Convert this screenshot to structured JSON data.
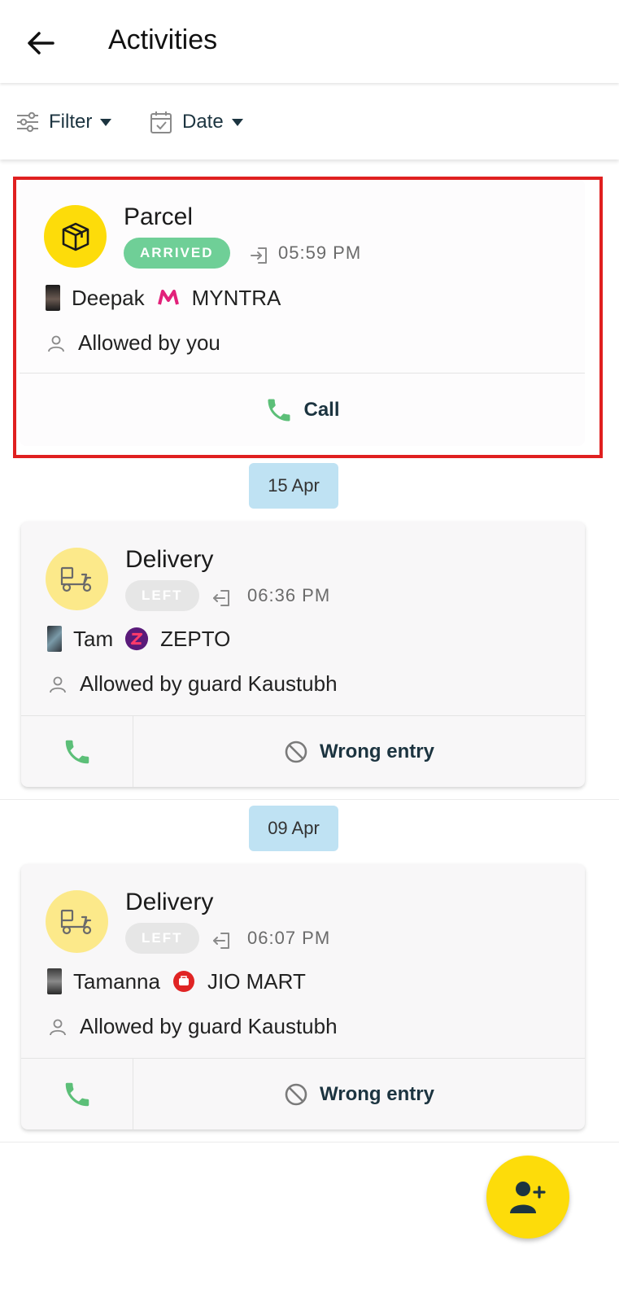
{
  "header": {
    "title": "Activities"
  },
  "filters": {
    "filter_label": "Filter",
    "date_label": "Date"
  },
  "activities": [
    {
      "type": "Parcel",
      "status": "ARRIVED",
      "time": "05:59 PM",
      "person": "Deepak",
      "vendor": "MYNTRA",
      "allowed_by": "Allowed by you",
      "call_label": "Call"
    },
    {
      "date": "15 Apr",
      "type": "Delivery",
      "status": "LEFT",
      "time": "06:36 PM",
      "person": "Tam",
      "vendor": "ZEPTO",
      "allowed_by": "Allowed by guard Kaustubh",
      "wrong_label": "Wrong entry"
    },
    {
      "date": "09 Apr",
      "type": "Delivery",
      "status": "LEFT",
      "time": "06:07 PM",
      "person": "Tamanna",
      "vendor": "JIO MART",
      "allowed_by": "Allowed by guard Kaustubh",
      "wrong_label": "Wrong entry"
    }
  ],
  "colors": {
    "accent_yellow": "#fddc0a",
    "arrived_green": "#6fcf97",
    "call_green": "#5cbf78",
    "date_chip": "#bfe2f3",
    "highlight_red": "#e02020"
  },
  "icons": {
    "back": "arrow-left-icon",
    "filter": "sliders-icon",
    "date": "calendar-check-icon",
    "parcel": "package-icon",
    "delivery": "delivery-scooter-icon",
    "entry": "login-icon",
    "exit": "logout-icon",
    "person": "person-outline-icon",
    "call": "phone-icon",
    "wrong": "block-icon",
    "fab": "add-person-icon"
  }
}
